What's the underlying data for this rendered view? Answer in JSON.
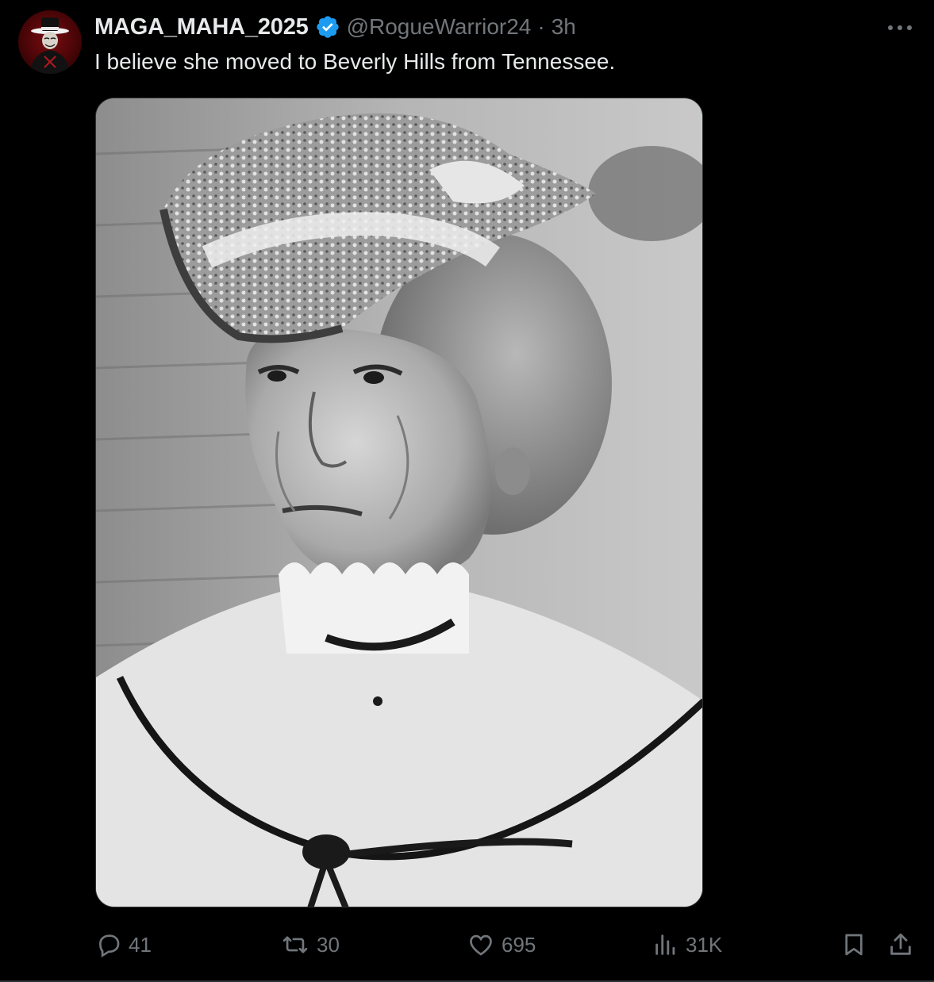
{
  "tweet": {
    "display_name": "MAGA_MAHA_2025",
    "handle": "@RogueWarrior24",
    "separator": "·",
    "time": "3h",
    "text": "I believe she moved to Beverly Hills from Tennessee.",
    "media_alt": "Black-and-white photo of an elderly woman in a hat and lace-collared blouse"
  },
  "actions": {
    "replies": "41",
    "reposts": "30",
    "likes": "695",
    "views": "31K"
  },
  "colors": {
    "background": "#000000",
    "text": "#e7e9ea",
    "muted": "#71767b",
    "verified": "#1d9bf0",
    "border": "#2f3336"
  },
  "icons": {
    "avatar": "avatar-icon",
    "verified": "verified-badge-icon",
    "more": "more-dots-icon",
    "reply": "reply-icon",
    "repost": "repost-icon",
    "like": "heart-icon",
    "views": "views-chart-icon",
    "bookmark": "bookmark-icon",
    "share": "share-icon"
  }
}
